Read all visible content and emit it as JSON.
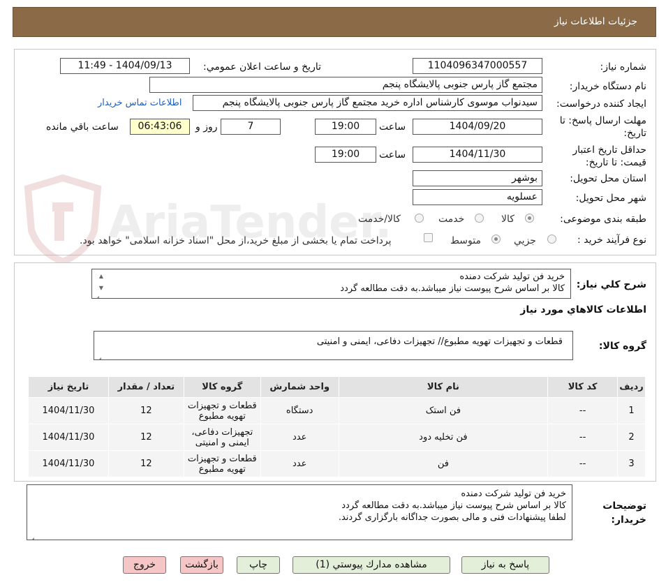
{
  "header": {
    "title": "جزئیات اطلاعات نیاز"
  },
  "fields": {
    "need_number_label": "شماره نیاز:",
    "need_number": "1104096347000557",
    "announce_label": "تاریخ و ساعت اعلان عمومي:",
    "announce_value": "1404/09/13 - 11:49",
    "buyer_org_label": "نام دستگاه خریدار:",
    "buyer_org": "مجتمع گاز پارس جنوبی  پالایشگاه پنجم",
    "requester_label": "ایجاد کننده درخواست:",
    "requester": "سیدنواب موسوی کارشناس اداره خرید مجتمع گاز پارس جنوبی  پالایشگاه پنجم",
    "contact_link": "اطلاعات تماس خریدار",
    "reply_deadline_label": "مهلت ارسال پاسخ: تا تاریخ:",
    "reply_date": "1404/09/20",
    "time_label": "ساعت",
    "reply_time": "19:00",
    "days_value": "7",
    "days_label": "روز و",
    "remaining_time": "06:43:06",
    "remaining_label": "ساعت باقي مانده",
    "validity_label": "حداقل تاریخ اعتبار قیمت: تا تاریخ:",
    "validity_date": "1404/11/30",
    "validity_time": "19:00",
    "province_label": "استان محل تحویل:",
    "province": "بوشهر",
    "city_label": "شهر محل تحویل:",
    "city": "عسلویه",
    "category_label": "طبقه بندی موضوعی:",
    "category_options": [
      "کالا",
      "خدمت",
      "کالا/خدمت"
    ],
    "process_label": "نوع فرآیند خرید :",
    "process_options": [
      "جزیي",
      "متوسط"
    ],
    "payment_note": "پرداخت تمام یا بخشی از مبلغ خرید،از محل \"اسناد خزانه اسلامی\" خواهد بود."
  },
  "summary": {
    "label": "شرح کلي نیاز:",
    "lines": [
      "خرید فن تولید شرکت دمنده",
      "کالا بر اساس شرح پیوست نیاز میباشد.به دقت مطالعه گردد"
    ]
  },
  "goods": {
    "section_title": "اطلاعات کالاهاي مورد نیاز",
    "group_label": "گروه کالا:",
    "group_value": "قطعات و تجهیزات تهویه مطبوع// تجهیزات دفاعی، ایمنی و امنیتی"
  },
  "table": {
    "headers": [
      "ردیف",
      "کد کالا",
      "نام کالا",
      "واحد شمارش",
      "گروه کالا",
      "تعداد / مقدار",
      "تاریخ نیاز"
    ],
    "rows": [
      [
        "1",
        "--",
        "فن استک",
        "دستگاه",
        "قطعات و تجهیزات تهویه مطبوع",
        "12",
        "1404/11/30"
      ],
      [
        "2",
        "--",
        "فن تخلیه دود",
        "عدد",
        "تجهیزات دفاعی، ایمنی و امنیتی",
        "12",
        "1404/11/30"
      ],
      [
        "3",
        "--",
        "فن",
        "عدد",
        "قطعات و تجهیزات تهویه مطبوع",
        "12",
        "1404/11/30"
      ]
    ]
  },
  "buyer_notes": {
    "label": "توضیحات خریدار:",
    "lines": [
      "خرید فن تولید شرکت دمنده",
      "کالا بر اساس شرح پیوست نیاز میباشد.به دقت مطالعه گردد",
      "لطفا پیشنهادات فنی و مالی بصورت جداگانه بارگزاری گردند."
    ]
  },
  "buttons": {
    "reply": "پاسخ به نیاز",
    "attachments": "مشاهده مدارك پيوستي (1)",
    "print": "چاپ",
    "back": "بازگشت",
    "exit": "خروج"
  },
  "watermark": {
    "text": "AriaTender.neT"
  },
  "colors": {
    "header": "#8b6b47",
    "button_green": "#e4efd9",
    "button_pink": "#f6c6c6",
    "highlight": "#ffffcc"
  }
}
